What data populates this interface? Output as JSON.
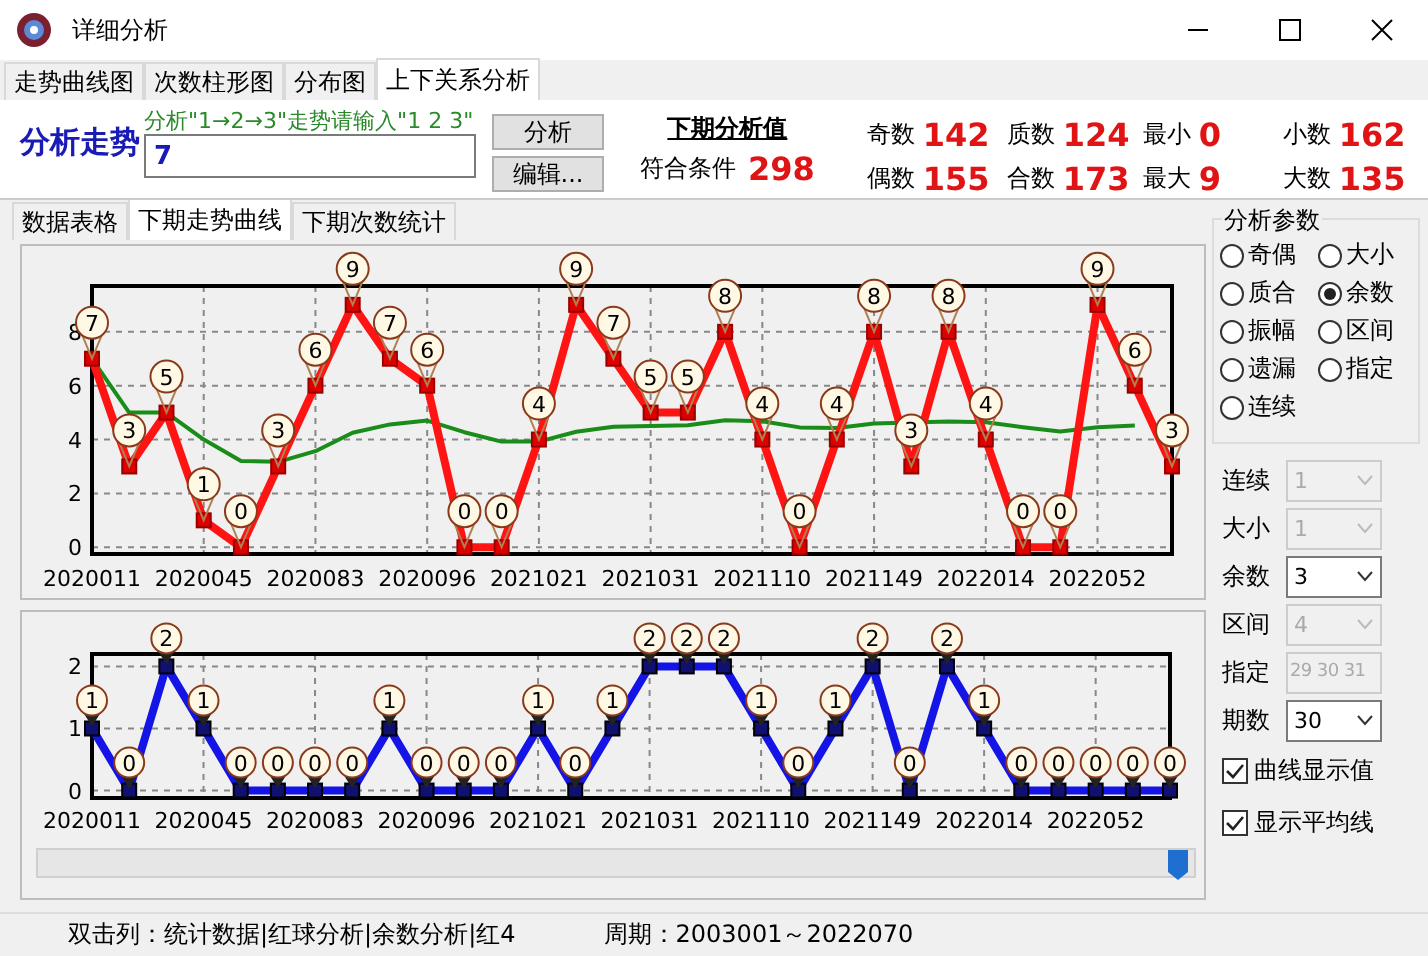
{
  "window": {
    "title": "详细分析"
  },
  "tabs": [
    {
      "label": "走势曲线图",
      "selected": false
    },
    {
      "label": "次数柱形图",
      "selected": false
    },
    {
      "label": "分布图",
      "selected": false
    },
    {
      "label": "上下关系分析",
      "selected": true
    }
  ],
  "analysis": {
    "label": "分析走势",
    "hint": "分析\"1→2→3\"走势请输入\"1 2 3\"",
    "input_value": "7",
    "buttons": [
      "分析",
      "编辑..."
    ],
    "next_title": "下期分析值",
    "match_label": "符合条件",
    "match_value": "298",
    "stats": [
      {
        "label": "奇数",
        "value": "142"
      },
      {
        "label": "偶数",
        "value": "155"
      },
      {
        "label": "质数",
        "value": "124"
      },
      {
        "label": "合数",
        "value": "173"
      },
      {
        "label": "最小",
        "value": "0"
      },
      {
        "label": "最大",
        "value": "9"
      },
      {
        "label": "小数",
        "value": "162"
      },
      {
        "label": "大数",
        "value": "135"
      }
    ]
  },
  "sub_tabs": [
    {
      "label": "数据表格",
      "selected": false
    },
    {
      "label": "下期走势曲线",
      "selected": true
    },
    {
      "label": "下期次数统计",
      "selected": false
    }
  ],
  "charts": [
    {
      "chart_data": {
        "type": "line",
        "grid": true,
        "ylim": [
          -0.25,
          9.7
        ],
        "yticks": [
          0,
          2,
          4,
          6,
          8
        ],
        "categories": [
          "2020011",
          null,
          null,
          "2020045",
          null,
          null,
          "2020083",
          null,
          null,
          "2020096",
          null,
          null,
          "2021021",
          null,
          null,
          "2021031",
          null,
          null,
          "2021110",
          null,
          null,
          "2021149",
          null,
          null,
          "2022014",
          null,
          null,
          "2022052",
          null,
          null
        ],
        "series": [
          {
            "color": "#ff1414",
            "marker": "square",
            "values": [
              7,
              3,
              5,
              1,
              0,
              3,
              6,
              9,
              7,
              6,
              0,
              0,
              4,
              9,
              7,
              5,
              5,
              8,
              4,
              0,
              4,
              8,
              3,
              8,
              4,
              0,
              0,
              9,
              6,
              3
            ]
          },
          {
            "color": "#1a8c1a",
            "values": [
              7,
              5,
              5,
              4,
              3.2,
              3.17,
              3.57,
              4.25,
              4.56,
              4.7,
              4.27,
              3.92,
              3.92,
              4.29,
              4.47,
              4.5,
              4.53,
              4.72,
              4.68,
              4.45,
              4.43,
              4.59,
              null,
              4.67,
              4.64,
              4.46,
              4.3,
              4.46,
              4.52,
              null
            ]
          }
        ],
        "value_labels": [
          [
            "7",
            "3",
            "5",
            "1",
            "0",
            "3",
            "6",
            "9",
            "7",
            "6",
            "0",
            "0",
            "4",
            "9",
            "7",
            "5",
            "5",
            "8",
            "4",
            "0",
            "4",
            "8",
            "3",
            "8",
            "4",
            "0",
            "0",
            "9",
            "6",
            "3"
          ],
          null
        ]
      }
    },
    {
      "chart_data": {
        "type": "line",
        "grid": true,
        "ylim": [
          -0.12,
          2.2
        ],
        "yticks": [
          0,
          1,
          2
        ],
        "categories": [
          "2020011",
          null,
          null,
          "2020045",
          null,
          null,
          "2020083",
          null,
          null,
          "2020096",
          null,
          null,
          "2021021",
          null,
          null,
          "2021031",
          null,
          null,
          "2021110",
          null,
          null,
          "2021149",
          null,
          null,
          "2022014",
          null,
          null,
          "2022052",
          null,
          null
        ],
        "series": [
          {
            "color": "#1414e6",
            "marker": "square",
            "values": [
              1,
              0,
              2,
              1,
              0,
              0,
              0,
              0,
              1,
              0,
              0,
              0,
              1,
              0,
              1,
              2,
              2,
              2,
              1,
              0,
              1,
              2,
              0,
              2,
              1,
              0,
              0,
              0,
              0,
              0
            ]
          }
        ],
        "data_labels": true
      }
    }
  ],
  "params": {
    "title": "分析参数",
    "options": [
      {
        "label": "奇偶",
        "selected": false
      },
      {
        "label": "大小",
        "selected": false
      },
      {
        "label": "质合",
        "selected": false
      },
      {
        "label": "余数",
        "selected": true
      },
      {
        "label": "振幅",
        "selected": false
      },
      {
        "label": "区间",
        "selected": false
      },
      {
        "label": "遗漏",
        "selected": false
      },
      {
        "label": "指定",
        "selected": false
      },
      {
        "label": "连续",
        "selected": false
      }
    ],
    "fields": [
      {
        "label": "连续",
        "kind": "dropdown",
        "value": "1",
        "disabled": true
      },
      {
        "label": "大小",
        "kind": "dropdown",
        "value": "1",
        "disabled": true
      },
      {
        "label": "余数",
        "kind": "dropdown",
        "value": "3",
        "disabled": false
      },
      {
        "label": "区间",
        "kind": "dropdown",
        "value": "4",
        "disabled": true
      },
      {
        "label": "指定",
        "kind": "text",
        "value": "29 30 31",
        "disabled": true
      },
      {
        "label": "期数",
        "kind": "dropdown",
        "value": "30",
        "disabled": false
      }
    ],
    "checkboxes": [
      {
        "label": "曲线显示值",
        "checked": true
      },
      {
        "label": "显示平均线",
        "checked": true
      }
    ]
  },
  "status_bar": [
    "双击列：统计数据|红球分析|余数分析|红4",
    "周期：2003001～2022070"
  ]
}
